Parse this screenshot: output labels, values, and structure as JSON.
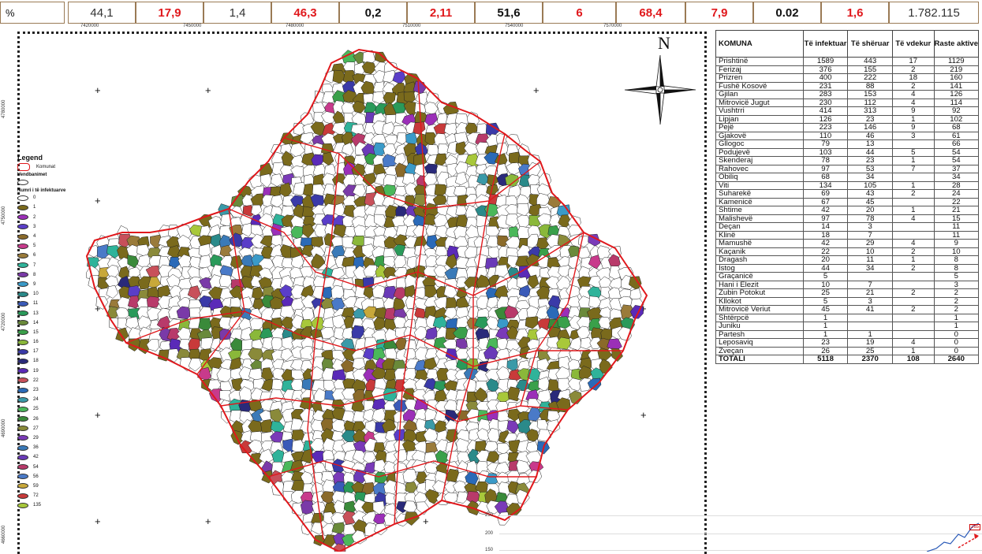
{
  "stats": {
    "label": "%",
    "values": [
      "44,1",
      "17,9",
      "1,4",
      "46,3",
      "0,2",
      "2,11",
      "51,6",
      "6",
      "68,4",
      "7,9",
      "0.02",
      "1,6",
      "1.782.115"
    ]
  },
  "easting_ticks": [
    "7420000",
    "7450000",
    "7480000",
    "7510000",
    "7540000",
    "7570000"
  ],
  "northing_ticks": [
    "4780000",
    "4750000",
    "4720000",
    "4690000",
    "4660000"
  ],
  "compass_letter": "N",
  "legend": {
    "title": "Legend",
    "komunat_label": "Komunat",
    "vendbanimet_label": "Vendbanimet",
    "numri_label": "Numri i të infektuarve",
    "classes": [
      {
        "value": "0",
        "color": "#ffffff"
      },
      {
        "value": "1",
        "color": "#7a6a1c"
      },
      {
        "value": "2",
        "color": "#9b2fb8"
      },
      {
        "value": "3",
        "color": "#5a3ec8"
      },
      {
        "value": "4",
        "color": "#8a6a2a"
      },
      {
        "value": "5",
        "color": "#c83a8c"
      },
      {
        "value": "6",
        "color": "#9a7b3a"
      },
      {
        "value": "7",
        "color": "#2fb39a"
      },
      {
        "value": "8",
        "color": "#7a3aa8"
      },
      {
        "value": "9",
        "color": "#3a9ac8"
      },
      {
        "value": "10",
        "color": "#2a8a8a"
      },
      {
        "value": "11",
        "color": "#3a5ab8"
      },
      {
        "value": "13",
        "color": "#2a9a5a"
      },
      {
        "value": "14",
        "color": "#6a8a3a"
      },
      {
        "value": "15",
        "color": "#3aa04a"
      },
      {
        "value": "16",
        "color": "#8ab83a"
      },
      {
        "value": "17",
        "color": "#3a3aa8"
      },
      {
        "value": "18",
        "color": "#2a2a7a"
      },
      {
        "value": "19",
        "color": "#5a2ab8"
      },
      {
        "value": "22",
        "color": "#c8505a"
      },
      {
        "value": "23",
        "color": "#2a6ab8"
      },
      {
        "value": "24",
        "color": "#3a9aa8"
      },
      {
        "value": "25",
        "color": "#4ab85a"
      },
      {
        "value": "26",
        "color": "#3a8a3a"
      },
      {
        "value": "27",
        "color": "#8a8a3a"
      },
      {
        "value": "29",
        "color": "#7a3ab8"
      },
      {
        "value": "36",
        "color": "#3a7ab8"
      },
      {
        "value": "42",
        "color": "#6a3ab8"
      },
      {
        "value": "54",
        "color": "#b83a6a"
      },
      {
        "value": "56",
        "color": "#4a7ac8"
      },
      {
        "value": "59",
        "color": "#c8a83a"
      },
      {
        "value": "72",
        "color": "#c83a3a"
      },
      {
        "value": "135",
        "color": "#a8c83a"
      }
    ]
  },
  "table": {
    "headers": [
      "KOMUNA",
      "Të infektuar",
      "Të shëruar",
      "Të vdekur",
      "Raste aktive"
    ],
    "rows": [
      [
        "Prishtinë",
        "1589",
        "443",
        "17",
        "1129"
      ],
      [
        "Ferizaj",
        "376",
        "155",
        "2",
        "219"
      ],
      [
        "Prizren",
        "400",
        "222",
        "18",
        "160"
      ],
      [
        "Fushë Kosovë",
        "231",
        "88",
        "2",
        "141"
      ],
      [
        "Gjilan",
        "283",
        "153",
        "4",
        "126"
      ],
      [
        "Mitrovicë Jugut",
        "230",
        "112",
        "4",
        "114"
      ],
      [
        "Vushtrri",
        "414",
        "313",
        "9",
        "92"
      ],
      [
        "Lipjan",
        "126",
        "23",
        "1",
        "102"
      ],
      [
        "Pejë",
        "223",
        "146",
        "9",
        "68"
      ],
      [
        "Gjakovë",
        "110",
        "46",
        "3",
        "61"
      ],
      [
        "Gllogoc",
        "79",
        "13",
        "",
        "66"
      ],
      [
        "Podujevë",
        "103",
        "44",
        "5",
        "54"
      ],
      [
        "Skenderaj",
        "78",
        "23",
        "1",
        "54"
      ],
      [
        "Rahovec",
        "97",
        "53",
        "7",
        "37"
      ],
      [
        "Obiliq",
        "68",
        "34",
        "",
        "34"
      ],
      [
        "Viti",
        "134",
        "105",
        "1",
        "28"
      ],
      [
        "Suharekë",
        "69",
        "43",
        "2",
        "24"
      ],
      [
        "Kamenicë",
        "67",
        "45",
        "",
        "22"
      ],
      [
        "Shtime",
        "42",
        "20",
        "1",
        "21"
      ],
      [
        "Malishevë",
        "97",
        "78",
        "4",
        "15"
      ],
      [
        "Deçan",
        "14",
        "3",
        "",
        "11"
      ],
      [
        "Klinë",
        "18",
        "7",
        "",
        "11"
      ],
      [
        "Mamushë",
        "42",
        "29",
        "4",
        "9"
      ],
      [
        "Kaçanik",
        "22",
        "10",
        "2",
        "10"
      ],
      [
        "Dragash",
        "20",
        "11",
        "1",
        "8"
      ],
      [
        "Istog",
        "44",
        "34",
        "2",
        "8"
      ],
      [
        "Graçanicë",
        "5",
        "",
        "",
        "5"
      ],
      [
        "Hani i Elezit",
        "10",
        "7",
        "",
        "3"
      ],
      [
        "Zubin Potokut",
        "25",
        "21",
        "2",
        "2"
      ],
      [
        "Kllokot",
        "5",
        "3",
        "",
        "2"
      ],
      [
        "Mitrovicë Veriut",
        "45",
        "41",
        "2",
        "2"
      ],
      [
        "Shtërpcë",
        "1",
        "",
        "",
        "1"
      ],
      [
        "Juniku",
        "1",
        "",
        "",
        "1"
      ],
      [
        "Partesh",
        "1",
        "1",
        "",
        "0"
      ],
      [
        "Leposaviq",
        "23",
        "19",
        "4",
        "0"
      ],
      [
        "Zveçan",
        "26",
        "25",
        "1",
        "0"
      ]
    ],
    "total": [
      "TOTALI",
      "5118",
      "2370",
      "108",
      "2640"
    ]
  },
  "mini_chart": {
    "y_ticks": [
      "250",
      "200",
      "150"
    ],
    "peak_label": "265"
  },
  "colors": {
    "border_red": "#e0181c",
    "stat_border": "#9a7a55"
  }
}
